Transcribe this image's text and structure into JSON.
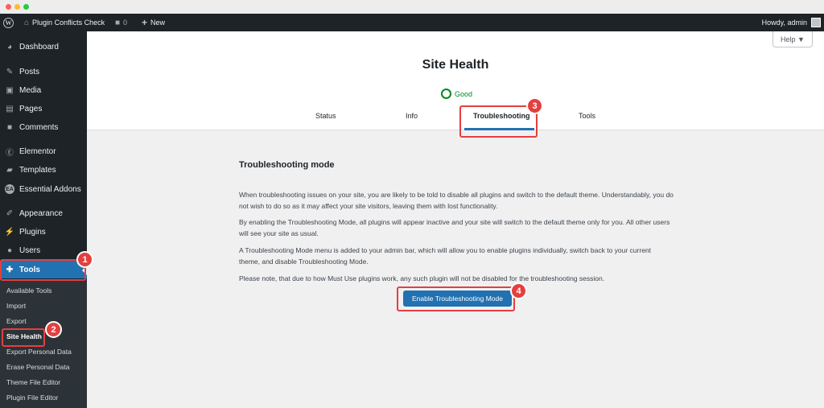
{
  "adminbar": {
    "site_name": "Plugin Conflicts Check",
    "comments_count": "0",
    "new_label": "New",
    "howdy": "Howdy, admin"
  },
  "sidebar": {
    "items": [
      {
        "label": "Dashboard",
        "icon": "dashboard-icon"
      },
      {
        "label": "Posts",
        "icon": "pin-icon"
      },
      {
        "label": "Media",
        "icon": "media-icon"
      },
      {
        "label": "Pages",
        "icon": "pages-icon"
      },
      {
        "label": "Comments",
        "icon": "comment-icon"
      },
      {
        "label": "Elementor",
        "icon": "elementor-icon"
      },
      {
        "label": "Templates",
        "icon": "folder-icon"
      },
      {
        "label": "Essential Addons",
        "icon": "ea-icon"
      },
      {
        "label": "Appearance",
        "icon": "brush-icon"
      },
      {
        "label": "Plugins",
        "icon": "plug-icon"
      },
      {
        "label": "Users",
        "icon": "user-icon"
      },
      {
        "label": "Tools",
        "icon": "wrench-icon"
      }
    ],
    "submenu": [
      "Available Tools",
      "Import",
      "Export",
      "Site Health",
      "Export Personal Data",
      "Erase Personal Data",
      "Theme File Editor",
      "Plugin File Editor"
    ]
  },
  "header": {
    "help_label": "Help ▼",
    "title": "Site Health",
    "status": "Good",
    "tabs": [
      "Status",
      "Info",
      "Troubleshooting",
      "Tools"
    ]
  },
  "main": {
    "section_title": "Troubleshooting mode",
    "paragraphs": [
      "When troubleshooting issues on your site, you are likely to be told to disable all plugins and switch to the default theme. Understandably, you do not wish to do so as it may affect your site visitors, leaving them with lost functionality.",
      "By enabling the Troubleshooting Mode, all plugins will appear inactive and your site will switch to the default theme only for you. All other users will see your site as usual.",
      "A Troubleshooting Mode menu is added to your admin bar, which will allow you to enable plugins individually, switch back to your current theme, and disable Troubleshooting Mode.",
      "Please note, that due to how Must Use plugins work, any such plugin will not be disabled for the troubleshooting session."
    ],
    "button_label": "Enable Troubleshooting Mode"
  },
  "callouts": [
    "1",
    "2",
    "3",
    "4"
  ],
  "colors": {
    "admin_dark": "#1d2327",
    "accent_blue": "#2271b1",
    "good_green": "#008a20",
    "callout_red": "#e43f3f"
  }
}
